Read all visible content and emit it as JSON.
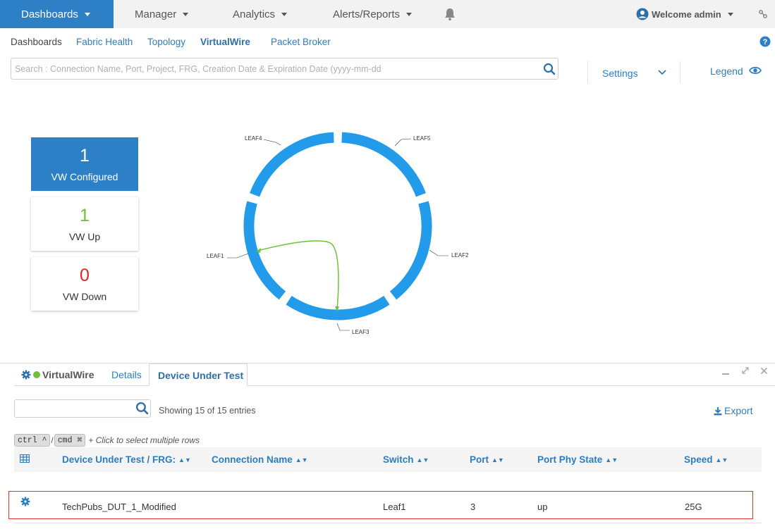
{
  "nav": {
    "dashboards": "Dashboards",
    "manager": "Manager",
    "analytics": "Analytics",
    "alerts": "Alerts/Reports",
    "welcome": "Welcome admin"
  },
  "subnav": {
    "dashboards": "Dashboards",
    "fabric_health": "Fabric Health",
    "topology": "Topology",
    "virtualwire": "VirtualWire",
    "packet_broker": "Packet Broker"
  },
  "search": {
    "placeholder": "Search : Connection Name, Port, Project, FRG, Creation Date & Expiration Date (yyyy-mm-dd"
  },
  "toolbar": {
    "settings": "Settings",
    "legend": "Legend"
  },
  "stats": {
    "configured": {
      "value": "1",
      "label": "VW Configured"
    },
    "up": {
      "value": "1",
      "label": "VW Up",
      "color": "#6cc23a"
    },
    "down": {
      "value": "0",
      "label": "VW Down",
      "color": "#e0262a"
    }
  },
  "topology": {
    "nodes": [
      "LEAF4",
      "LEAF5",
      "LEAF2",
      "LEAF3",
      "LEAF1"
    ],
    "ring_color": "#229bea",
    "link_color": "#6cc23a",
    "link": {
      "from": "LEAF1",
      "to": "LEAF3"
    }
  },
  "panel": {
    "tabs": {
      "virtualwire": "VirtualWire",
      "details": "Details",
      "device_under_test": "Device Under Test"
    },
    "showing": "Showing 15 of 15 entries",
    "export": "Export",
    "hint": {
      "ctrl": "ctrl ^",
      "slash": "/",
      "cmd": "cmd ⌘",
      "text": "+ Click to select multiple rows"
    }
  },
  "table": {
    "columns": [
      "Device Under Test / FRG:",
      "Connection Name",
      "Switch",
      "Port",
      "Port Phy State",
      "Speed"
    ],
    "rows": [
      {
        "dut": "TechPubs_DUT_1_Modified",
        "connection": "",
        "switch": "Leaf1",
        "port": "3",
        "state": "up",
        "speed": "25G"
      }
    ]
  }
}
